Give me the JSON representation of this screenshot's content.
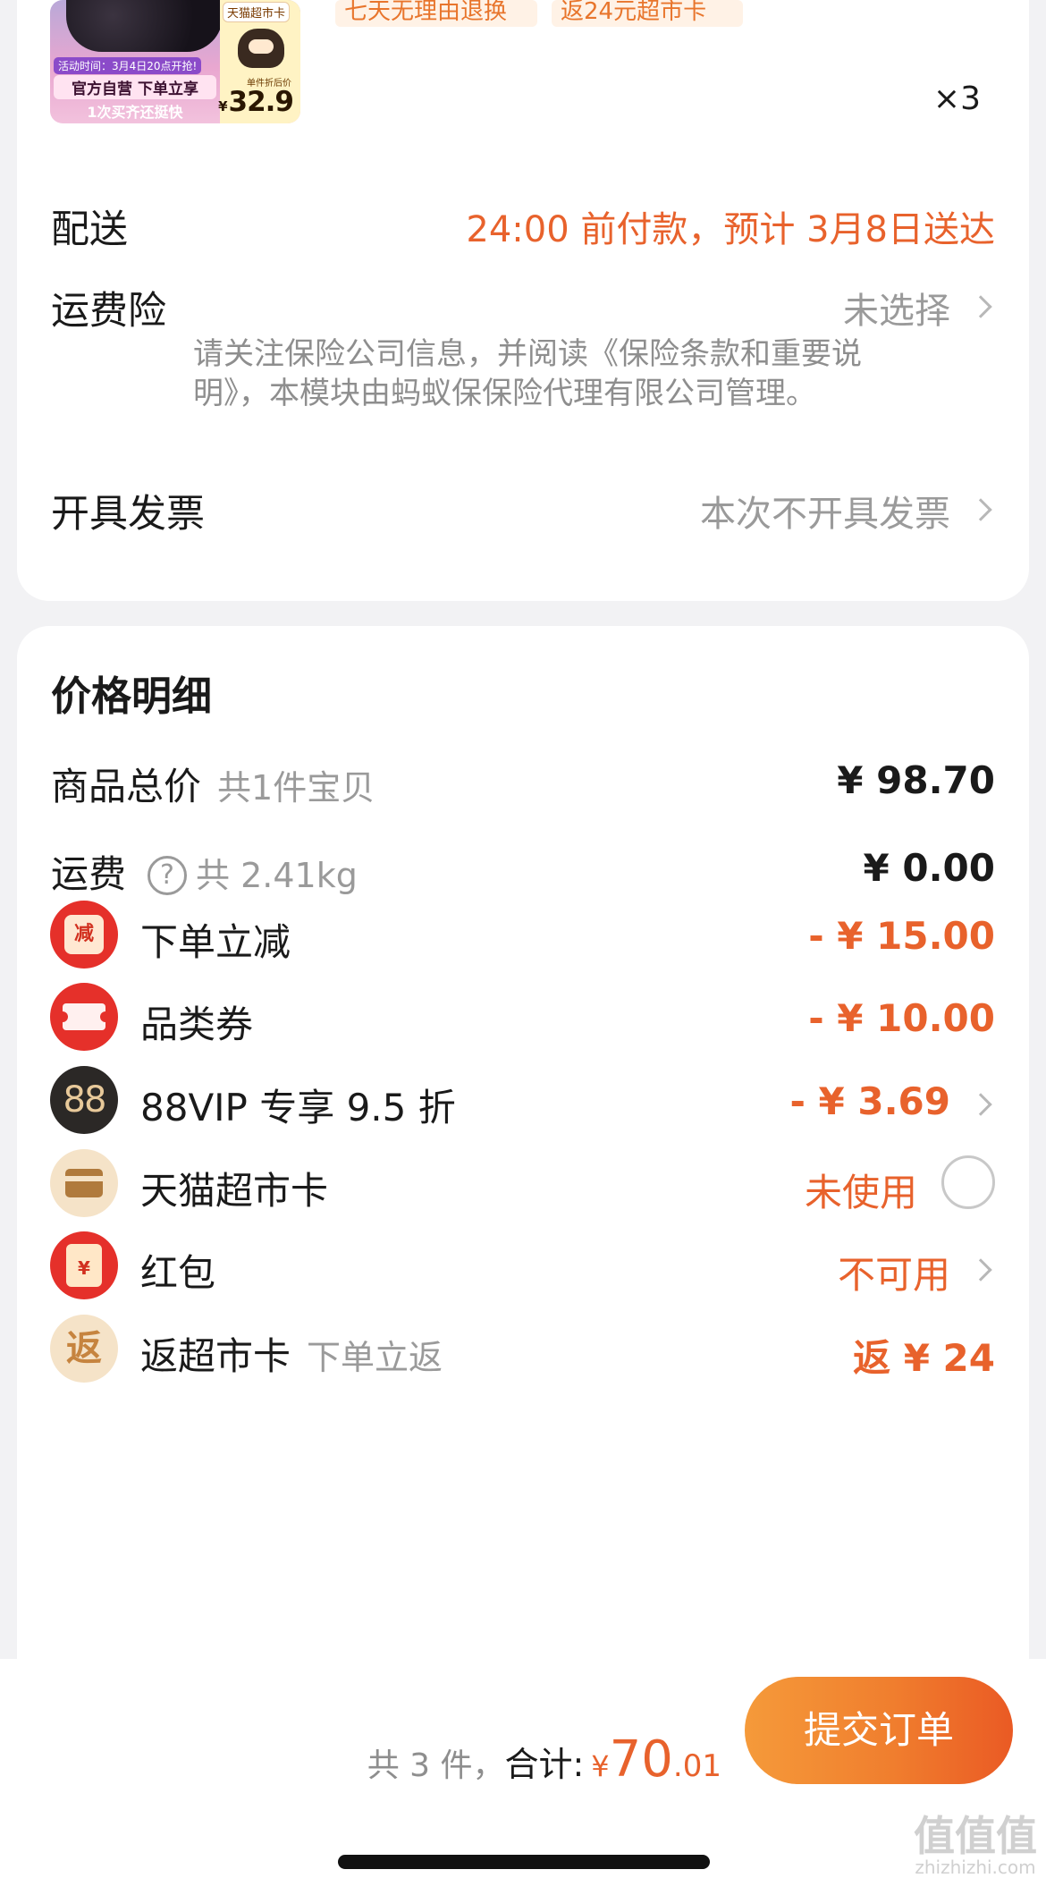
{
  "product": {
    "thumb_brand": "天猫超市卡",
    "thumb_event": "活动时间：3月4日20点开抢!",
    "thumb_slogan": "官方自营 下单立享",
    "thumb_sub": "1次买齐还挺快",
    "thumb_price_label": "单件折后价",
    "thumb_price_yen": "¥",
    "thumb_price": "32.9",
    "tag_return": "七天无理由退换",
    "tag_rebate": "返24元超市卡",
    "quantity": "×3"
  },
  "order_info": {
    "delivery_label": "配送",
    "delivery_value": "24:00 前付款，预计 3月8日送达",
    "insurance_label": "运费险",
    "insurance_value": "未选择",
    "insurance_note": "请关注保险公司信息，并阅读《保险条款和重要说明》，本模块由蚂蚁保保险代理有限公司管理。",
    "invoice_label": "开具发票",
    "invoice_value": "本次不开具发票"
  },
  "price_detail": {
    "title": "价格明细",
    "goods_total_label": "商品总价",
    "goods_total_sub": "共1件宝贝",
    "goods_total_value": "¥ 98.70",
    "shipping_label": "运费",
    "shipping_help_glyph": "?",
    "shipping_sub": "共 2.41kg",
    "shipping_value": "¥ 0.00",
    "instant_discount_icon_text": "减",
    "instant_discount_label": "下单立减",
    "instant_discount_value": "- ¥ 15.00",
    "category_coupon_label": "品类券",
    "category_coupon_value": "- ¥ 10.00",
    "vip_icon_text": "88",
    "vip_label": "88VIP 专享 9.5 折",
    "vip_value": "- ¥ 3.69",
    "tmall_card_label": "天猫超市卡",
    "tmall_card_value": "未使用",
    "red_packet_icon_text": "¥",
    "red_packet_label": "红包",
    "red_packet_value": "不可用",
    "rebate_icon_text": "返",
    "rebate_label": "返超市卡",
    "rebate_sub": "下单立返",
    "rebate_value": "返 ¥ 24"
  },
  "bottom_bar": {
    "count_text": "共 3 件，",
    "total_label": "合计:",
    "total_yen": "¥",
    "total_int": "70",
    "total_dec": ".01",
    "submit_label": "提交订单"
  },
  "watermark": {
    "glyphs": "值值值",
    "site": "zhizhizhi.com"
  },
  "colors": {
    "accent_orange": "#e8622c",
    "badge_red": "#e5302a",
    "muted_gray": "#9a9a9a"
  }
}
